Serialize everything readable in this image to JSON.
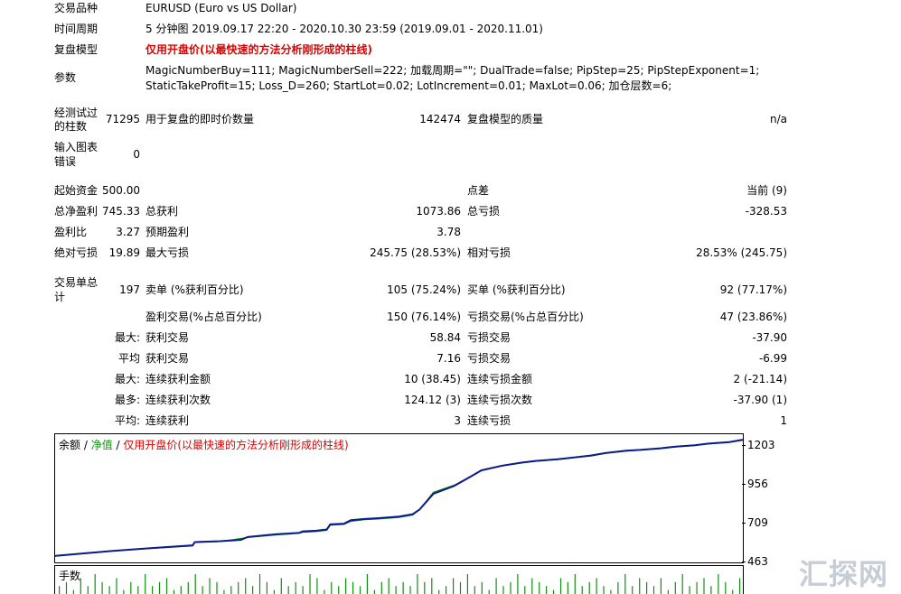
{
  "header": {
    "symbol_label": "交易品种",
    "symbol_value": "EURUSD (Euro vs US Dollar)",
    "period_label": "时间周期",
    "period_value": "5 分钟图 2019.09.17 22:20 - 2020.10.30 23:59 (2019.09.01 - 2020.11.01)",
    "model_label": "复盘模型",
    "model_value": "仅用开盘价(以最快速的方法分析刚形成的柱线)",
    "params_label": "参数",
    "params_line1": "MagicNumberBuy=111; MagicNumberSell=222; 加载周期=\"\"; DualTrade=false; PipStep=25; PipStepExponent=1;",
    "params_line2": "StaticTakeProfit=15; Loss_D=260; StartLot=0.02; LotIncrement=0.01; MaxLot=0.06; 加仓层数=6;"
  },
  "bars": {
    "label_line1": "经测试过",
    "label_line2": "的柱数",
    "value": "71295",
    "ticks_label": "用于复盘的即时价数量",
    "ticks_value": "142474",
    "quality_label": "复盘模型的质量",
    "quality_value": "n/a",
    "errors_label_line1": "输入图表",
    "errors_label_line2": "错误",
    "errors_value": "0"
  },
  "stats": {
    "initial_deposit_label": "起始资金",
    "initial_deposit_value": "500.00",
    "spread_label": "点差",
    "spread_value": "当前 (9)",
    "net_profit_label": "总净盈利",
    "net_profit_value": "745.33",
    "gross_profit_label": "总获利",
    "gross_profit_value": "1073.86",
    "gross_loss_label": "总亏损",
    "gross_loss_value": "-328.53",
    "profit_factor_label": "盈利比",
    "profit_factor_value": "3.27",
    "expected_payoff_label": "预期盈利",
    "expected_payoff_value": "3.78",
    "abs_drawdown_label": "绝对亏损",
    "abs_drawdown_value": "19.89",
    "max_drawdown_label": "最大亏损",
    "max_drawdown_value": "245.75 (28.53%)",
    "rel_drawdown_label": "相对亏损",
    "rel_drawdown_value": "28.53% (245.75)",
    "total_trades_label_line1": "交易单总",
    "total_trades_label_line2": "计",
    "total_trades_value": "197",
    "short_label": "卖单 (%获利百分比)",
    "short_value": "105 (75.24%)",
    "long_label": "买单 (%获利百分比)",
    "long_value": "92 (77.17%)",
    "profit_trades_label": "盈利交易(%占总百分比)",
    "profit_trades_value": "150 (76.14%)",
    "loss_trades_label": "亏损交易(%占总百分比)",
    "loss_trades_value": "47 (23.86%)",
    "largest_prefix": "最大:",
    "largest_profit_label": "获利交易",
    "largest_profit_value": "58.84",
    "largest_loss_label": "亏损交易",
    "largest_loss_value": "-37.90",
    "average_prefix": "平均",
    "avg_profit_label": "获利交易",
    "avg_profit_value": "7.16",
    "avg_loss_label": "亏损交易",
    "avg_loss_value": "-6.99",
    "max_prefix": "最大:",
    "max_consec_wins_label": "连续获利金额",
    "max_consec_wins_value": "10 (38.45)",
    "max_consec_losses_label": "连续亏损金额",
    "max_consec_losses_value": "2 (-21.14)",
    "most_prefix": "最多:",
    "max_consec_profit_label": "连续获利次数",
    "max_consec_profit_value": "124.12 (3)",
    "max_consec_loss_label": "连续亏损次数",
    "max_consec_loss_value": "-37.90 (1)",
    "avg2_prefix": "平均:",
    "avg_consec_wins_label": "连续获利",
    "avg_consec_wins_value": "3",
    "avg_consec_losses_label": "连续亏损",
    "avg_consec_losses_value": "1"
  },
  "chart_legend": {
    "balance": "余额",
    "sep1": " / ",
    "equity": "净值",
    "sep2": " / ",
    "model": "仅用开盘价(以最快速的方法分析刚形成的柱线)"
  },
  "volume_label": "手数",
  "watermark": "汇探网",
  "colors": {
    "balance": "#0b1a8c",
    "equity": "#109010",
    "model": "#e00000",
    "volume": "#109010"
  },
  "chart_data": {
    "type": "line",
    "ylim": [
      463,
      1280
    ],
    "yticks": [
      1203,
      956,
      709,
      463
    ],
    "series": [
      {
        "name": "余额",
        "x": [
          0,
          4,
          8,
          12,
          16,
          20,
          20.3,
          21,
          24,
          27,
          28,
          32,
          35.5,
          36,
          38,
          39.5,
          40,
          42,
          43,
          45,
          47,
          50,
          52,
          53,
          55,
          58,
          60,
          62,
          65,
          68,
          70,
          73,
          75,
          78,
          80,
          83,
          85,
          88,
          90,
          93,
          95,
          98,
          100
        ],
        "y": [
          505,
          520,
          535,
          548,
          560,
          572,
          592,
          594,
          598,
          607,
          625,
          642,
          652,
          661,
          665,
          673,
          705,
          710,
          732,
          740,
          745,
          755,
          770,
          800,
          900,
          950,
          1000,
          1050,
          1080,
          1100,
          1110,
          1120,
          1130,
          1145,
          1160,
          1175,
          1180,
          1190,
          1200,
          1210,
          1220,
          1230,
          1245
        ]
      },
      {
        "name": "净值",
        "x": [
          0,
          10,
          20,
          20.3,
          24,
          28,
          32,
          35.5,
          36,
          38,
          39.5,
          40,
          42,
          43,
          45,
          47,
          50,
          52,
          53,
          55,
          56,
          58,
          60,
          62,
          65,
          68,
          70,
          73,
          75,
          78,
          80,
          83,
          85,
          88,
          90,
          93,
          95,
          98,
          100
        ],
        "y": [
          503,
          542,
          568,
          590,
          596,
          622,
          638,
          648,
          655,
          660,
          668,
          700,
          705,
          725,
          735,
          740,
          750,
          765,
          800,
          910,
          925,
          955,
          1000,
          1048,
          1078,
          1098,
          1108,
          1118,
          1128,
          1142,
          1158,
          1172,
          1178,
          1188,
          1198,
          1208,
          1218,
          1228,
          1242
        ]
      }
    ],
    "volume": [
      2,
      3,
      1,
      4,
      2,
      5,
      3,
      2,
      4,
      1,
      3,
      2,
      5,
      2,
      3,
      4,
      1,
      2,
      3,
      5,
      2,
      4,
      3,
      1,
      2,
      3,
      4,
      2,
      5,
      3,
      1,
      4,
      2,
      3,
      2,
      5,
      4,
      1,
      3,
      2,
      4,
      3,
      2,
      5,
      1,
      3,
      4,
      2,
      3,
      2,
      5,
      3,
      4,
      1,
      2,
      4,
      3,
      5,
      2,
      3,
      1,
      4,
      2,
      3,
      5,
      2,
      4,
      3,
      2,
      1,
      4,
      3,
      5,
      2,
      3,
      4,
      2,
      1,
      3,
      5,
      2,
      4,
      3,
      2,
      4,
      1,
      3,
      5,
      2,
      3,
      4,
      2,
      5,
      3,
      1,
      4
    ]
  }
}
